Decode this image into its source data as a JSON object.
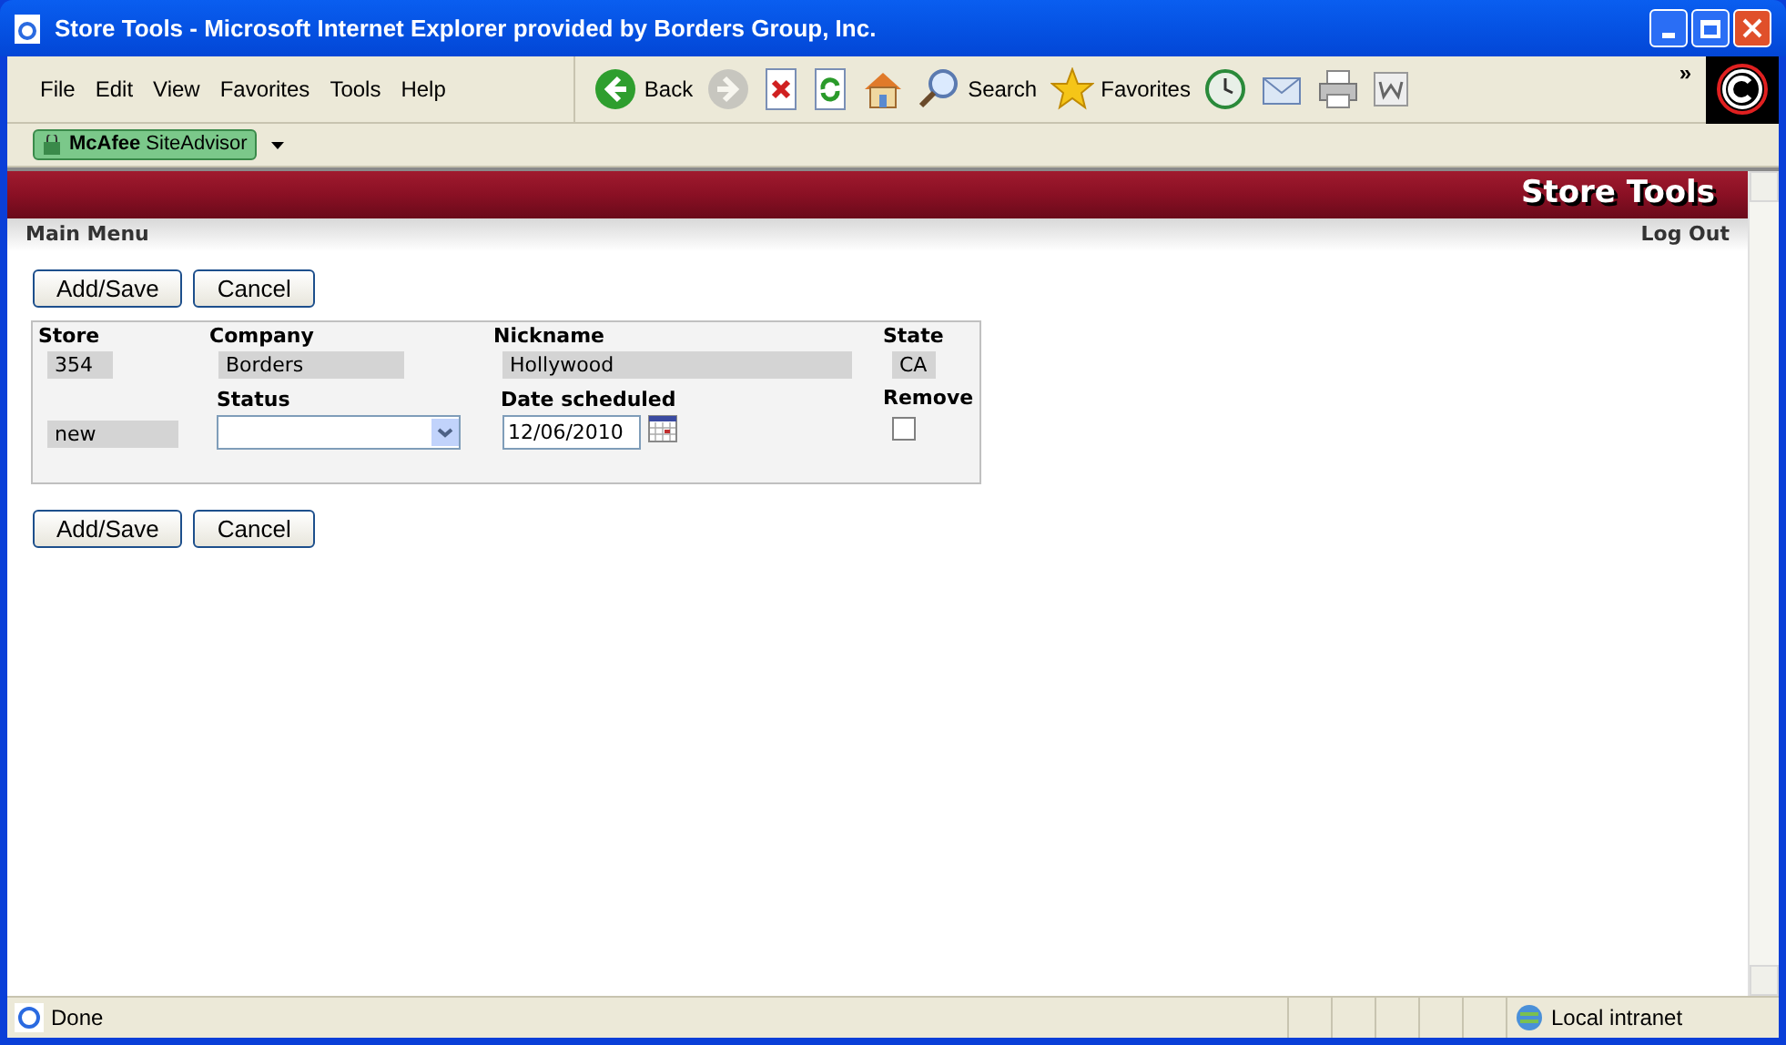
{
  "window": {
    "title": "Store Tools - Microsoft Internet Explorer provided by Borders Group, Inc."
  },
  "menu": [
    "File",
    "Edit",
    "View",
    "Favorites",
    "Tools",
    "Help"
  ],
  "toolbar": [
    {
      "kind": "back",
      "label": "Back",
      "disabled": false
    },
    {
      "kind": "forward",
      "disabled": true
    },
    {
      "kind": "stop",
      "disabled": false
    },
    {
      "kind": "refresh",
      "disabled": false
    },
    {
      "kind": "home",
      "disabled": false
    },
    {
      "kind": "search",
      "label": "Search",
      "disabled": false
    },
    {
      "kind": "favorites",
      "label": "Favorites",
      "disabled": false
    },
    {
      "kind": "history",
      "disabled": false
    },
    {
      "kind": "mail",
      "disabled": false
    },
    {
      "kind": "print",
      "disabled": false
    },
    {
      "kind": "word",
      "disabled": false
    }
  ],
  "chevron": "»",
  "links_bar": {
    "addon": "**McAfee** SiteAdvisor"
  },
  "page": {
    "header": "Store Tools",
    "nav_left": "Main Menu",
    "nav_right": "Log Out",
    "buttons_top": [
      "Add/Save",
      "Cancel"
    ],
    "form": {
      "store_label": "Store",
      "store": "354",
      "company_label": "Company",
      "company": "Borders",
      "nickname_label": "Nickname",
      "nickname": "Hollywood",
      "state_label": "State",
      "state": "CA",
      "type": "new",
      "status_label": "Status",
      "date_label": "Date scheduled",
      "date": "12/06/2010",
      "remove_label": "Remove",
      "remove_checked": false
    },
    "buttons_bottom": [
      "Add/Save",
      "Cancel"
    ]
  },
  "status_bar": {
    "text": "Done",
    "zone": "Local intranet"
  }
}
